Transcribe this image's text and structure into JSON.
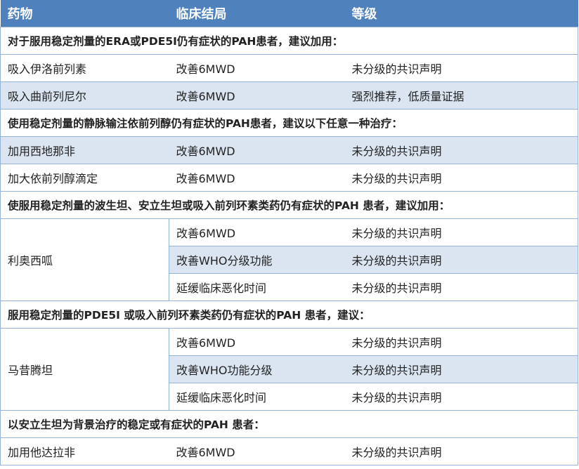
{
  "header": {
    "drug": "药物",
    "outcome": "临床结局",
    "grade": "等级"
  },
  "sections": [
    {
      "title": "对于服用稳定剂量的ERA或PDE5I仍有症状的PAH患者，建议加用：",
      "rows": [
        {
          "drug": "吸入伊洛前列素",
          "outcome": "改善6MWD",
          "grade": "未分级的共识声明"
        },
        {
          "drug": "吸入曲前列尼尔",
          "outcome": "改善6MWD",
          "grade": "强烈推荐，低质量证据"
        }
      ]
    },
    {
      "title": "使用稳定剂量的静脉输注依前列醇仍有症状的PAH患者，建议以下任意一种治疗：",
      "rows": [
        {
          "drug": "加用西地那非",
          "outcome": "改善6MWD",
          "grade": "未分级的共识声明"
        },
        {
          "drug": "加大依前列醇滴定",
          "outcome": "改善6MWD",
          "grade": "未分级的共识声明"
        }
      ]
    },
    {
      "title": "使服用稳定剂量的波生坦、安立生坦或吸入前列环素类药仍有症状的PAH 患者，建议加用：",
      "drug": "利奥西呱",
      "rows": [
        {
          "outcome": "改善6MWD",
          "grade": "未分级的共识声明"
        },
        {
          "outcome": "改善WHO分级功能",
          "grade": "未分级的共识声明"
        },
        {
          "outcome": "延缓临床恶化时间",
          "grade": "未分级的共识声明"
        }
      ]
    },
    {
      "title": "服用稳定剂量的PDE5I 或吸入前列环素类药仍有症状的PAH 患者，建议：",
      "drug": "马昔腾坦",
      "rows": [
        {
          "outcome": "改善6MWD",
          "grade": "未分级的共识声明"
        },
        {
          "outcome": "改善WHO功能分级",
          "grade": "未分级的共识声明"
        },
        {
          "outcome": "延缓临床恶化时间",
          "grade": "未分级的共识声明"
        }
      ]
    },
    {
      "title": "以安立生坦为背景治疗的稳定或有症状的PAH 患者：",
      "rows": [
        {
          "drug": "加用他达拉非",
          "outcome": "改善6MWD",
          "grade": "未分级的共识声明"
        }
      ]
    }
  ]
}
